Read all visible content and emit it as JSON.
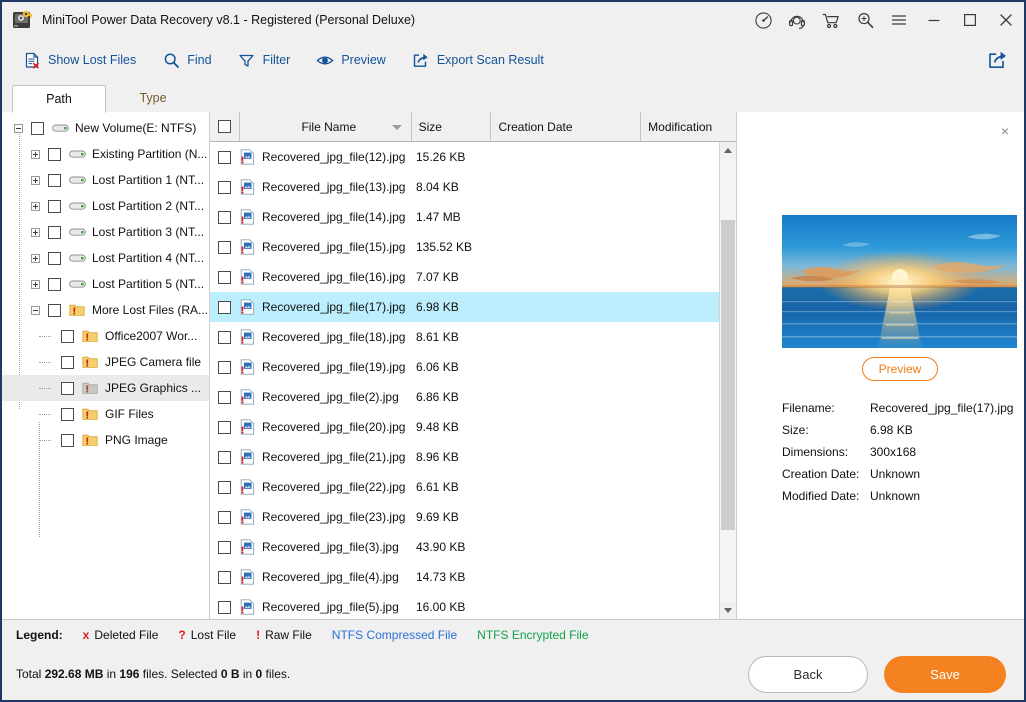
{
  "window": {
    "title": "MiniTool Power Data Recovery v8.1 - Registered (Personal Deluxe)",
    "app_icon": "disk-key-icon",
    "controls": [
      {
        "name": "speedometer-icon",
        "glyph": "speedometer"
      },
      {
        "name": "support-headset-icon",
        "glyph": "headset"
      },
      {
        "name": "shopping-cart-icon",
        "glyph": "cart"
      },
      {
        "name": "search-zoom-icon",
        "glyph": "zoom"
      },
      {
        "name": "menu-icon",
        "glyph": "hamburger"
      },
      {
        "name": "minimize-button",
        "glyph": "minimize"
      },
      {
        "name": "maximize-button",
        "glyph": "maximize"
      },
      {
        "name": "close-button",
        "glyph": "close"
      }
    ]
  },
  "toolbar": {
    "items": [
      {
        "label": "Show Lost Files",
        "icon": "lost-file-icon"
      },
      {
        "label": "Find",
        "icon": "search-icon"
      },
      {
        "label": "Filter",
        "icon": "filter-icon"
      },
      {
        "label": "Preview",
        "icon": "eye-icon"
      },
      {
        "label": "Export Scan Result",
        "icon": "export-icon"
      }
    ],
    "right_action": {
      "label": "Share",
      "icon": "share-export-icon"
    },
    "accent": "#14539a"
  },
  "tabs": [
    {
      "label": "Path",
      "active": true
    },
    {
      "label": "Type",
      "active": false
    }
  ],
  "tree": {
    "items": [
      {
        "label": "New Volume(E: NTFS)",
        "depth": 0,
        "state": "expanded",
        "icon": "drive-icon",
        "selected": false
      },
      {
        "label": "Existing Partition (N...",
        "depth": 1,
        "state": "collapsed",
        "icon": "drive-icon",
        "selected": false
      },
      {
        "label": "Lost Partition 1 (NT...",
        "depth": 1,
        "state": "collapsed",
        "icon": "drive-icon",
        "selected": false
      },
      {
        "label": "Lost Partition 2 (NT...",
        "depth": 1,
        "state": "collapsed",
        "icon": "drive-icon",
        "selected": false
      },
      {
        "label": "Lost Partition 3 (NT...",
        "depth": 1,
        "state": "collapsed",
        "icon": "drive-icon",
        "selected": false
      },
      {
        "label": "Lost Partition 4 (NT...",
        "depth": 1,
        "state": "collapsed",
        "icon": "drive-icon",
        "selected": false
      },
      {
        "label": "Lost Partition 5 (NT...",
        "depth": 1,
        "state": "collapsed",
        "icon": "drive-icon",
        "selected": false
      },
      {
        "label": "More Lost Files (RA...",
        "depth": 1,
        "state": "expanded",
        "icon": "raw-folder-icon",
        "selected": false
      },
      {
        "label": "Office2007 Wor...",
        "depth": 2,
        "state": "leaf",
        "icon": "raw-folder-icon",
        "selected": false
      },
      {
        "label": "JPEG Camera file",
        "depth": 2,
        "state": "leaf",
        "icon": "raw-folder-icon",
        "selected": false
      },
      {
        "label": "JPEG Graphics ...",
        "depth": 2,
        "state": "leaf",
        "icon": "raw-folder-icon-dim",
        "selected": true
      },
      {
        "label": "GIF Files",
        "depth": 2,
        "state": "leaf",
        "icon": "raw-folder-icon",
        "selected": false
      },
      {
        "label": "PNG Image",
        "depth": 2,
        "state": "leaf",
        "icon": "raw-folder-icon",
        "selected": false
      }
    ]
  },
  "filelist": {
    "columns": [
      {
        "key": "check",
        "label": ""
      },
      {
        "key": "name",
        "label": "File Name",
        "sorted": "desc"
      },
      {
        "key": "size",
        "label": "Size"
      },
      {
        "key": "created",
        "label": "Creation Date"
      },
      {
        "key": "modified",
        "label": "Modification"
      }
    ],
    "rows": [
      {
        "name": "Recovered_jpg_file(12).jpg",
        "size": "15.26 KB",
        "created": "",
        "modified": "",
        "selected": false
      },
      {
        "name": "Recovered_jpg_file(13).jpg",
        "size": "8.04 KB",
        "created": "",
        "modified": "",
        "selected": false
      },
      {
        "name": "Recovered_jpg_file(14).jpg",
        "size": "1.47 MB",
        "created": "",
        "modified": "",
        "selected": false
      },
      {
        "name": "Recovered_jpg_file(15).jpg",
        "size": "135.52 KB",
        "created": "",
        "modified": "",
        "selected": false
      },
      {
        "name": "Recovered_jpg_file(16).jpg",
        "size": "7.07 KB",
        "created": "",
        "modified": "",
        "selected": false
      },
      {
        "name": "Recovered_jpg_file(17).jpg",
        "size": "6.98 KB",
        "created": "",
        "modified": "",
        "selected": true
      },
      {
        "name": "Recovered_jpg_file(18).jpg",
        "size": "8.61 KB",
        "created": "",
        "modified": "",
        "selected": false
      },
      {
        "name": "Recovered_jpg_file(19).jpg",
        "size": "6.06 KB",
        "created": "",
        "modified": "",
        "selected": false
      },
      {
        "name": "Recovered_jpg_file(2).jpg",
        "size": "6.86 KB",
        "created": "",
        "modified": "",
        "selected": false
      },
      {
        "name": "Recovered_jpg_file(20).jpg",
        "size": "9.48 KB",
        "created": "",
        "modified": "",
        "selected": false
      },
      {
        "name": "Recovered_jpg_file(21).jpg",
        "size": "8.96 KB",
        "created": "",
        "modified": "",
        "selected": false
      },
      {
        "name": "Recovered_jpg_file(22).jpg",
        "size": "6.61 KB",
        "created": "",
        "modified": "",
        "selected": false
      },
      {
        "name": "Recovered_jpg_file(23).jpg",
        "size": "9.69 KB",
        "created": "",
        "modified": "",
        "selected": false
      },
      {
        "name": "Recovered_jpg_file(3).jpg",
        "size": "43.90 KB",
        "created": "",
        "modified": "",
        "selected": false
      },
      {
        "name": "Recovered_jpg_file(4).jpg",
        "size": "14.73 KB",
        "created": "",
        "modified": "",
        "selected": false
      },
      {
        "name": "Recovered_jpg_file(5).jpg",
        "size": "16.00 KB",
        "created": "",
        "modified": "",
        "selected": false
      }
    ]
  },
  "preview": {
    "close_label": "×",
    "image_alt": "sunset-over-ocean-thumbnail",
    "preview_button": "Preview",
    "meta": [
      {
        "key": "Filename:",
        "value": "Recovered_jpg_file(17).jpg"
      },
      {
        "key": "Size:",
        "value": "6.98 KB"
      },
      {
        "key": "Dimensions:",
        "value": "300x168"
      },
      {
        "key": "Creation Date:",
        "value": "Unknown"
      },
      {
        "key": "Modified Date:",
        "value": "Unknown"
      }
    ],
    "accent": "#ef7c1a"
  },
  "legend": {
    "title": "Legend:",
    "items": [
      {
        "mark": "x",
        "label": "Deleted File",
        "mark_color": "#e02020",
        "label_color": "#111111"
      },
      {
        "mark": "?",
        "label": "Lost File",
        "mark_color": "#e02020",
        "label_color": "#111111"
      },
      {
        "mark": "!",
        "label": "Raw File",
        "mark_color": "#e02020",
        "label_color": "#111111"
      },
      {
        "mark": "",
        "label": "NTFS Compressed File",
        "mark_color": "",
        "label_color": "#2d6fd8"
      },
      {
        "mark": "",
        "label": "NTFS Encrypted File",
        "mark_color": "",
        "label_color": "#13a04a"
      }
    ]
  },
  "status": {
    "total_prefix": "Total ",
    "total_size": "292.68 MB",
    "total_middle": " in ",
    "total_count": "196",
    "total_suffix": " files.  Selected ",
    "selected_size": "0 B",
    "selected_middle": " in ",
    "selected_count": "0",
    "selected_suffix": " files.",
    "back_label": "Back",
    "save_label": "Save",
    "save_color": "#f58220"
  }
}
